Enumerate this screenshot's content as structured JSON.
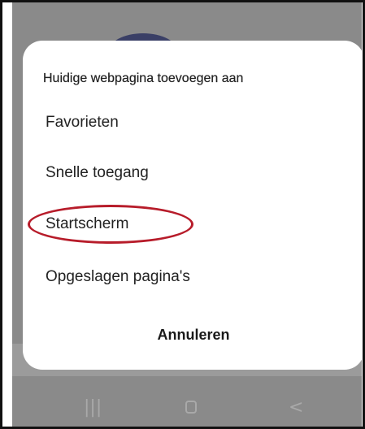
{
  "dialog": {
    "title": "Huidige webpagina toevoegen aan",
    "options": [
      {
        "label": "Favorieten"
      },
      {
        "label": "Snelle toegang"
      },
      {
        "label": "Startscherm"
      },
      {
        "label": "Opgeslagen pagina's"
      }
    ],
    "cancel_label": "Annuleren"
  },
  "navbar": {
    "recent_symbol": "|||",
    "back_symbol": "<"
  },
  "annotation": {
    "highlight_color": "#b71c2a",
    "highlighted_option": "Startscherm"
  },
  "colors": {
    "scrim": "#8a8a8a",
    "dialog_bg": "#ffffff"
  }
}
